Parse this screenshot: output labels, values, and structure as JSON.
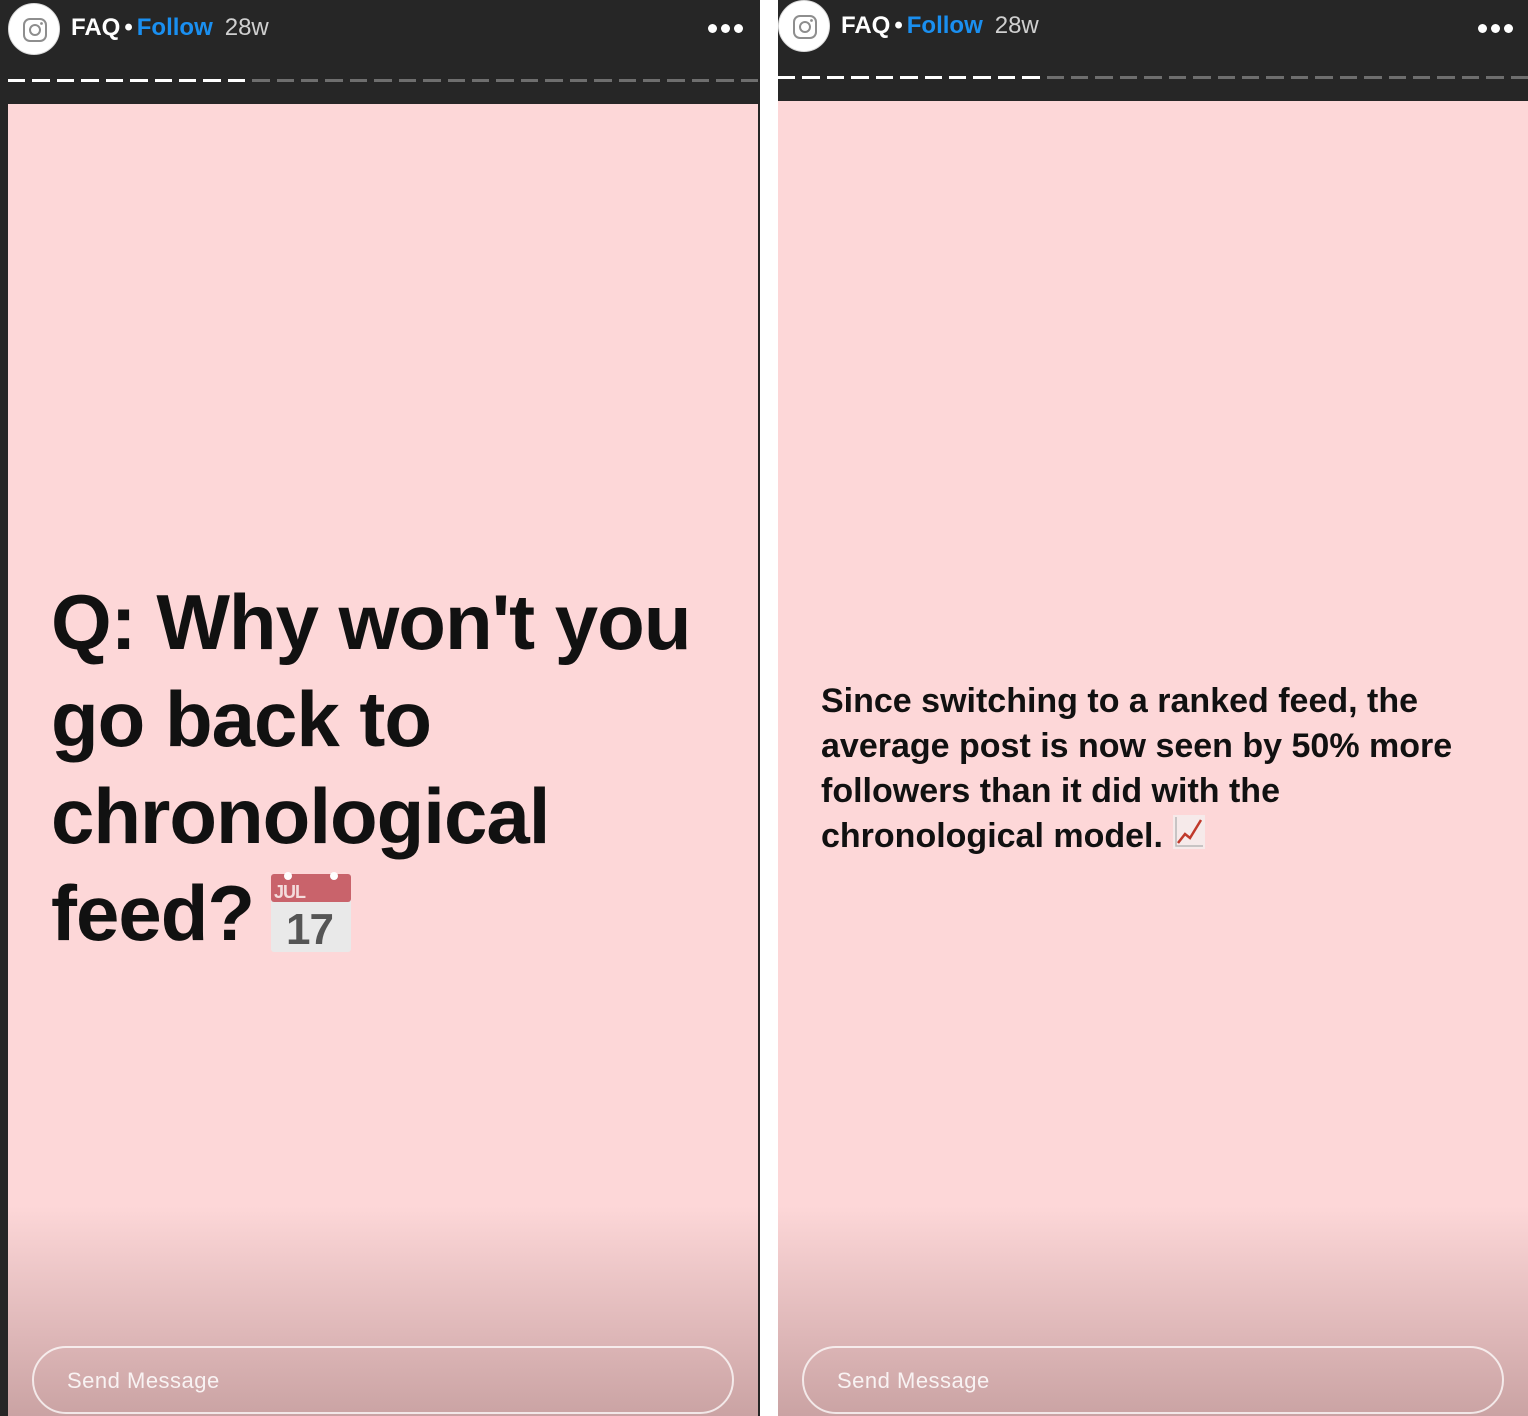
{
  "stories": [
    {
      "header": {
        "account": "FAQ",
        "separator": "•",
        "follow_label": "Follow",
        "age": "28w"
      },
      "progress": {
        "total_segments": 31,
        "completed_segments": 10
      },
      "content": {
        "text": "Q: Why won't you go back to chronological feed?",
        "emoji": "calendar-icon",
        "calendar_month": "JUL",
        "calendar_day": "17"
      },
      "background_color": "#fdd7d8",
      "message_placeholder": "Send Message"
    },
    {
      "header": {
        "account": "FAQ",
        "separator": "•",
        "follow_label": "Follow",
        "age": "28w"
      },
      "progress": {
        "total_segments": 31,
        "completed_segments": 11
      },
      "content": {
        "text": "Since switching to a ranked feed, the average post is now seen by 50% more followers than it did with the chronological model.",
        "emoji": "chart-increasing-icon"
      },
      "background_color": "#fdd7d8",
      "message_placeholder": "Send Message"
    }
  ],
  "colors": {
    "header_bg": "#262626",
    "follow": "#1a8ff0",
    "text": "#111111"
  }
}
